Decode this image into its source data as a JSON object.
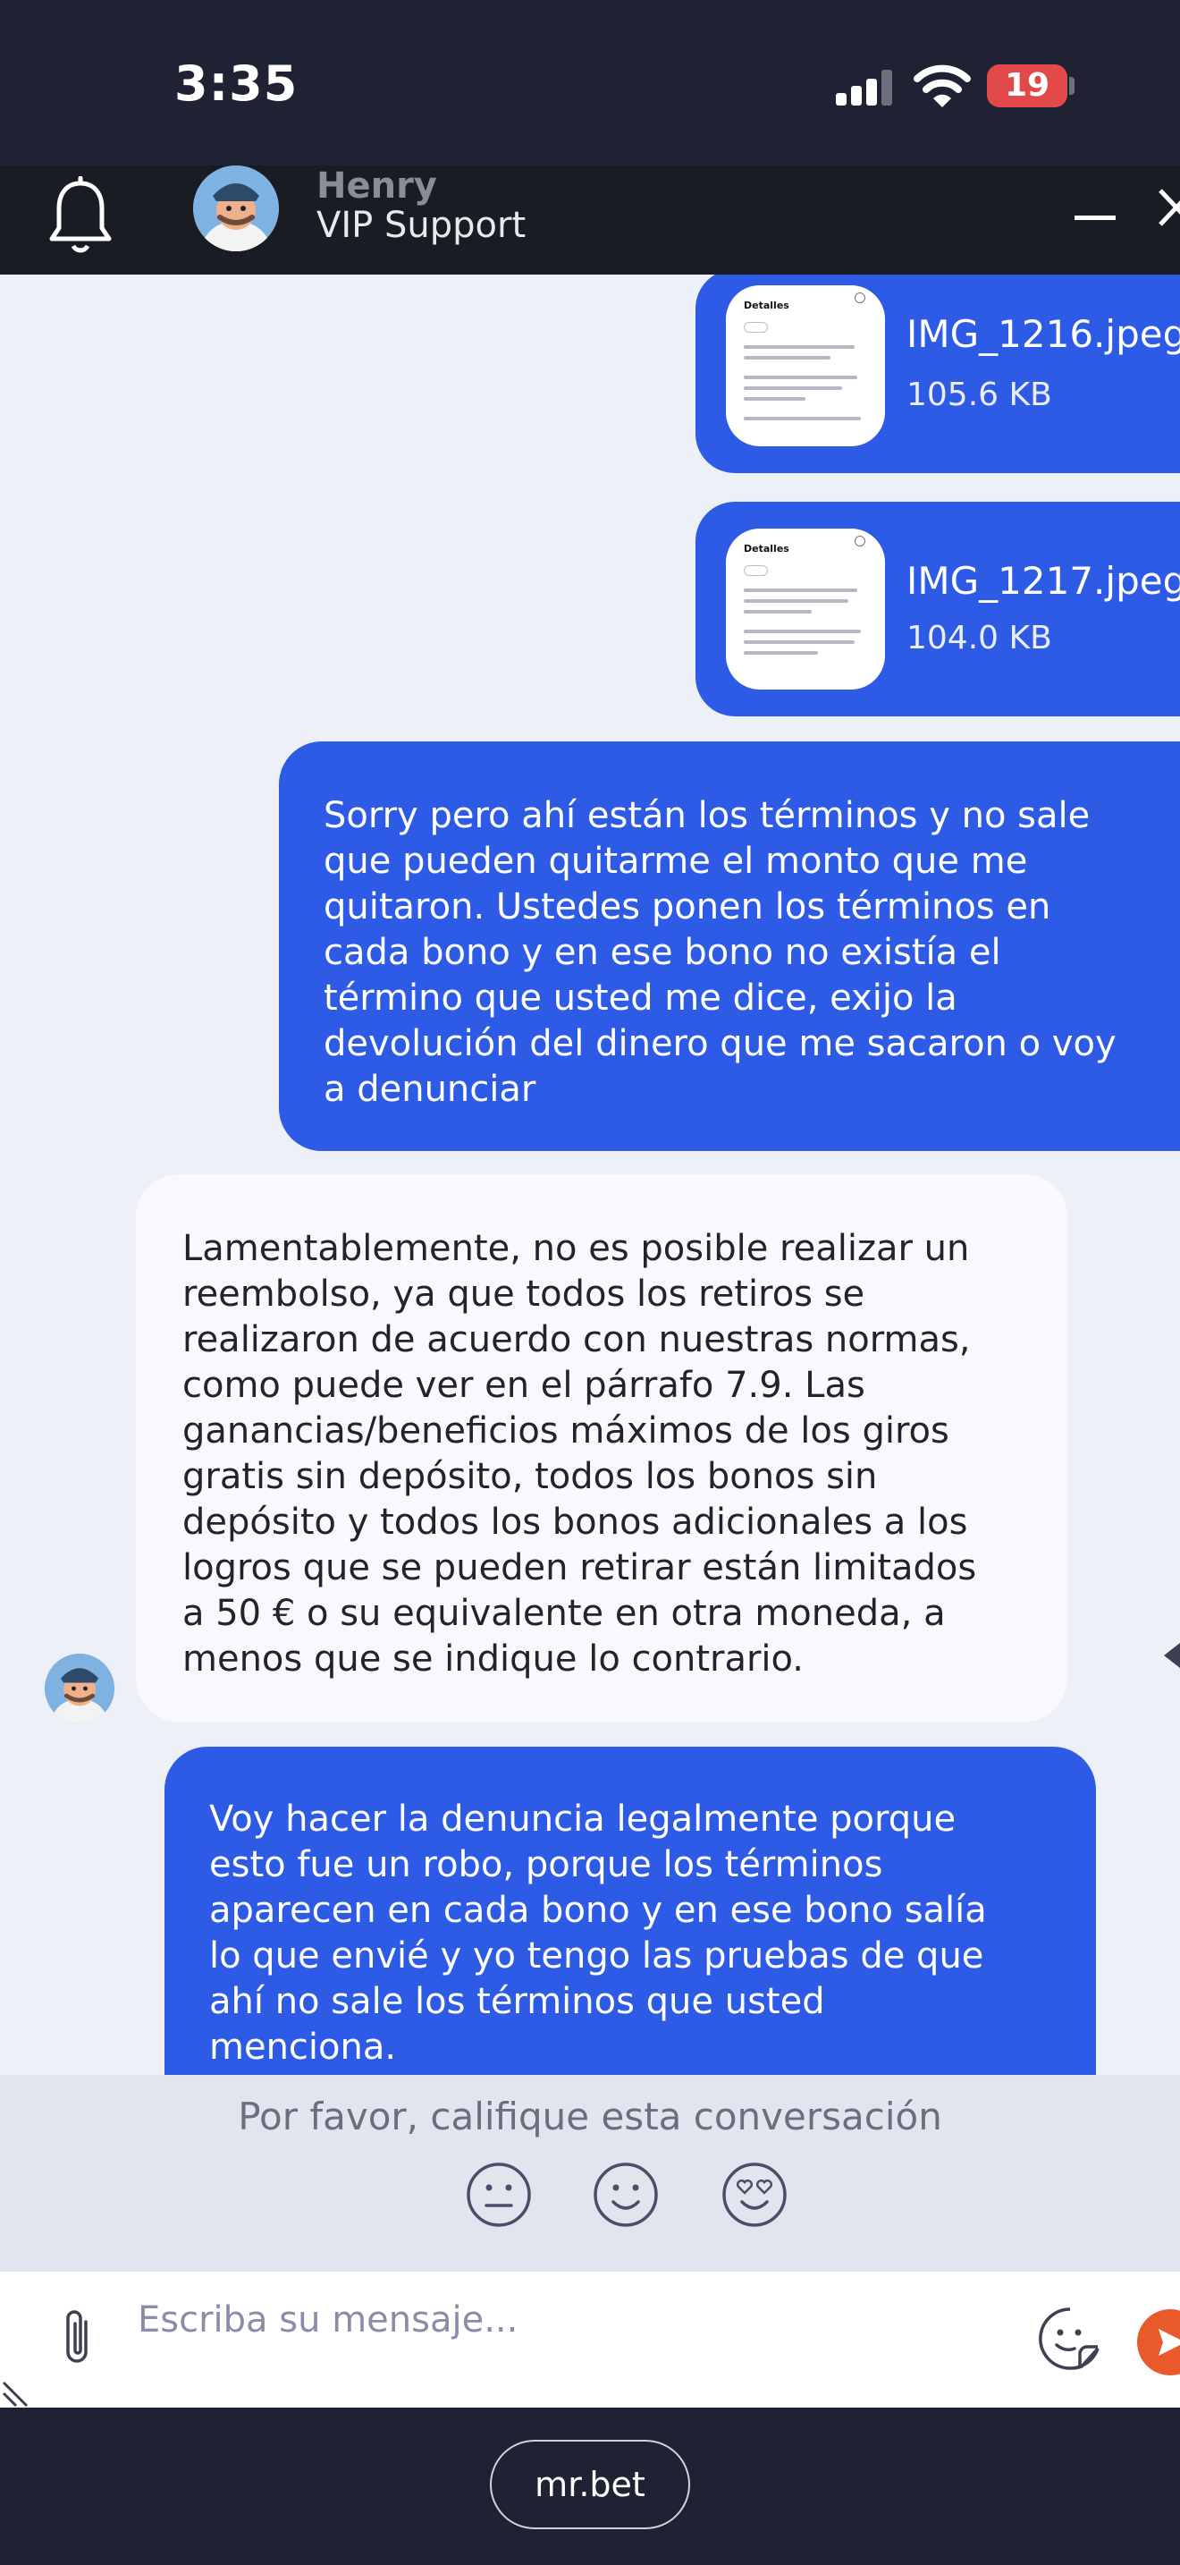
{
  "status_bar": {
    "time": "3:35",
    "battery": "19"
  },
  "header": {
    "agent_name": "Henry",
    "agent_role": "VIP Support",
    "icons": [
      "bell-icon",
      "minimize-icon",
      "close-icon"
    ]
  },
  "messages": [
    {
      "type": "file",
      "from": "user",
      "file_name": "IMG_1216.jpeg",
      "file_size": "105.6 KB",
      "thumb_title": "Detalles"
    },
    {
      "type": "file",
      "from": "user",
      "file_name": "IMG_1217.jpeg",
      "file_size": "104.0 KB",
      "thumb_title": "Detalles"
    },
    {
      "type": "text",
      "from": "user",
      "text": "Sorry pero ahí están los términos y no sale\nque pueden quitarme el monto que me\nquitaron. Ustedes ponen los términos en\ncada bono y en ese bono no existía el\ntérmino que usted me dice, exijo la\ndevolución del dinero que me sacaron o voy\na denunciar"
    },
    {
      "type": "text",
      "from": "agent",
      "text": "Lamentablemente, no es posible realizar un\nreembolso, ya que todos los retiros se\nrealizaron de acuerdo con nuestras normas,\ncomo puede ver en el párrafo 7.9. Las\nganancias/beneficios máximos de los giros\ngratis sin depósito, todos los bonos sin\ndepósito y todos los bonos adicionales a los\nlogros que se pueden retirar están limitados\na 50 € o su equivalente en otra moneda, a\nmenos que se indique lo contrario."
    },
    {
      "type": "text",
      "from": "user",
      "text": "Voy hacer la denuncia legalmente porque\nesto fue un robo, porque los términos\naparecen en cada bono y en ese bono salía\nlo que envié y yo tengo las pruebas de que\nahí no sale los términos que usted\nmenciona."
    }
  ],
  "rating": {
    "prompt": "Por favor, califique esta conversación",
    "options": [
      "neutral-face-icon",
      "smile-face-icon",
      "heart-eyes-face-icon"
    ]
  },
  "composer": {
    "placeholder": "Escriba su mensaje...",
    "value": ""
  },
  "browser": {
    "url": "mr.bet"
  },
  "colors": {
    "user_bubble": "#2e5be5",
    "agent_bubble": "#f9f9fd",
    "chat_bg": "#eef0f7",
    "header_bg": "#1a1c24",
    "send_button": "#e85a2a"
  }
}
